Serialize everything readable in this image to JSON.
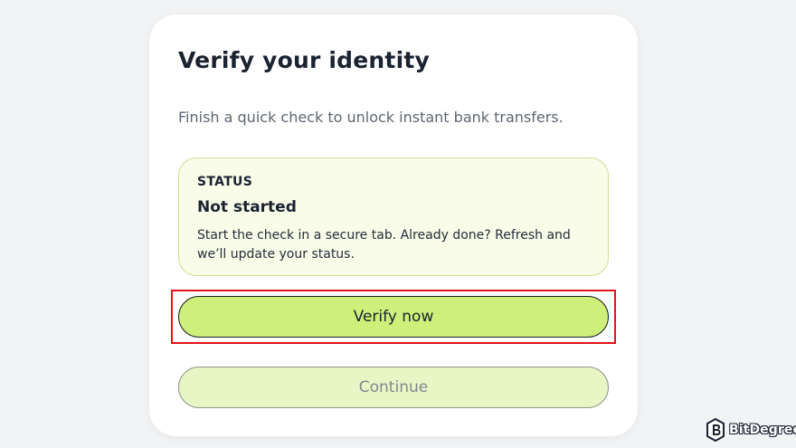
{
  "card": {
    "title": "Verify your identity",
    "subtitle": "Finish a quick check to unlock instant bank transfers."
  },
  "status": {
    "label": "STATUS",
    "value": "Not started",
    "description": "Start the check in a secure tab. Already done? Refresh and we’ll update your status."
  },
  "buttons": {
    "verify_label": "Verify now",
    "continue_label": "Continue"
  },
  "brand": {
    "name": "BitDegree",
    "icon": "bitdegree-logo-icon"
  },
  "colors": {
    "accent": "#cef07b",
    "highlight": "#e2141b",
    "status_bg": "#f9fce9"
  }
}
